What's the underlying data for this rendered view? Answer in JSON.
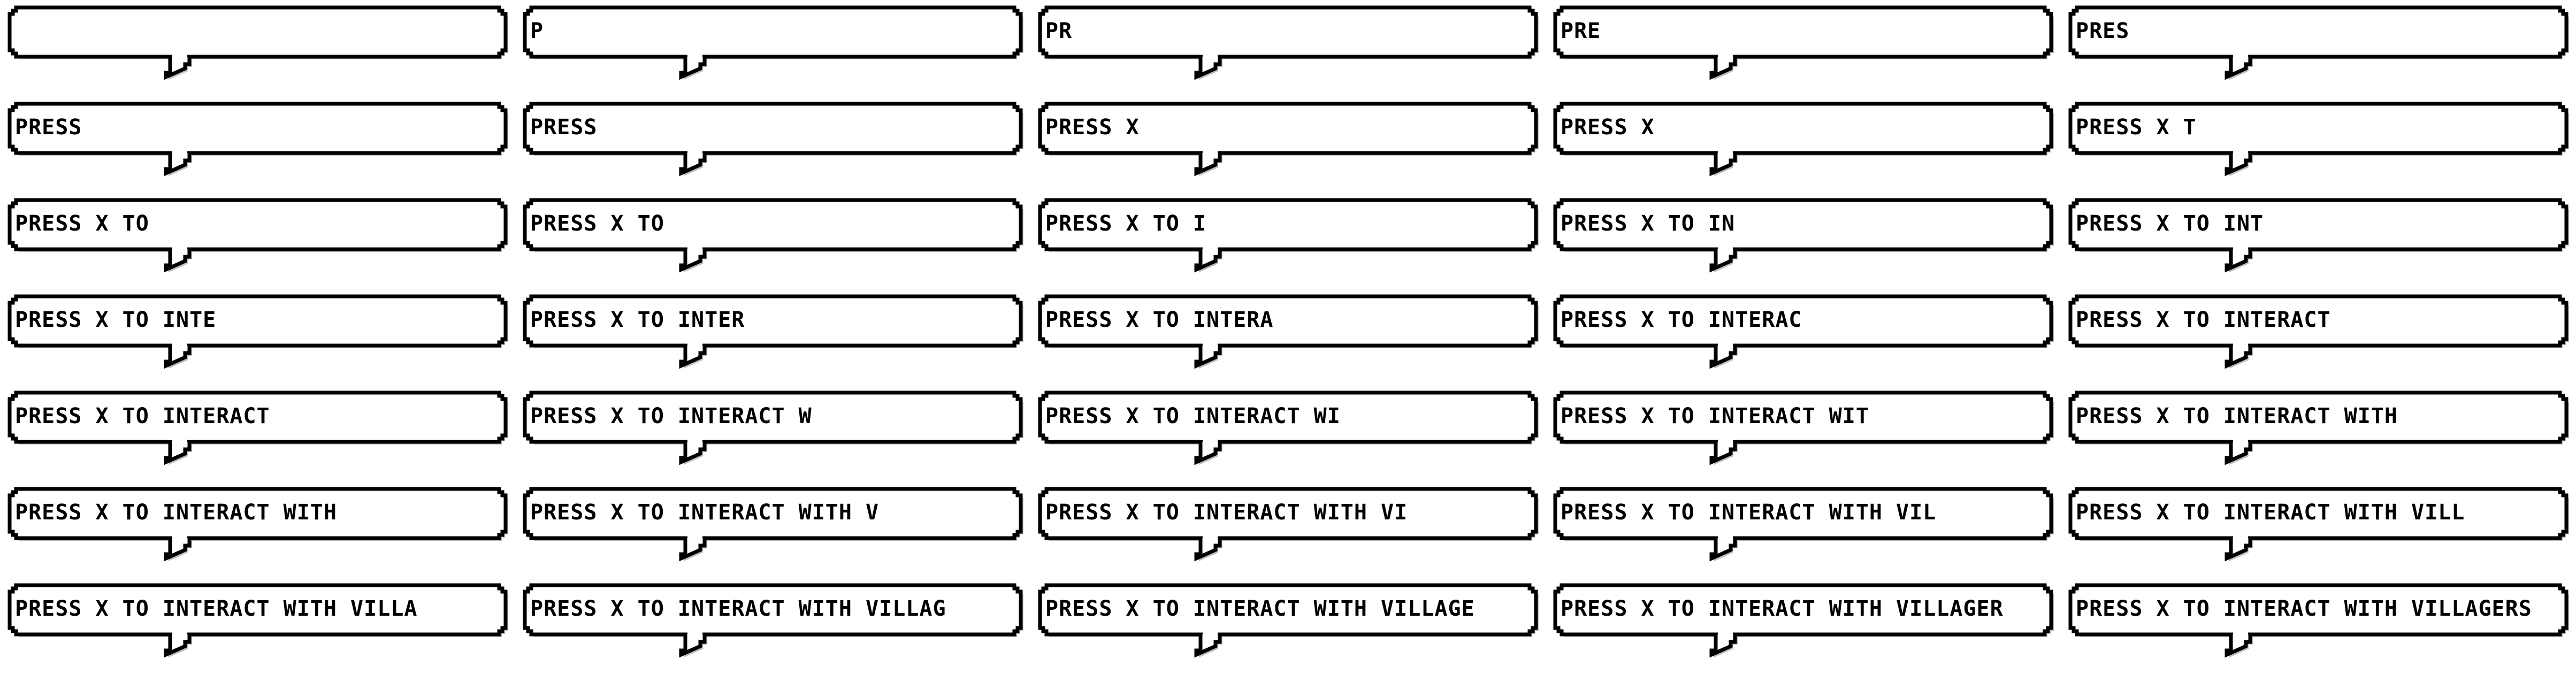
{
  "sprite_sheet": {
    "colors": {
      "outline": "#000000",
      "fill": "#ffffff",
      "shadow": "#bdbdbd"
    },
    "frames": [
      "",
      "P",
      "PR",
      "PRE",
      "PRES",
      "PRESS",
      "PRESS",
      "PRESS X",
      "PRESS X",
      "PRESS X T",
      "PRESS X TO",
      "PRESS X TO",
      "PRESS X TO I",
      "PRESS X TO IN",
      "PRESS X TO INT",
      "PRESS X TO INTE",
      "PRESS X TO INTER",
      "PRESS X TO INTERA",
      "PRESS X TO INTERAC",
      "PRESS X TO INTERACT",
      "PRESS X TO INTERACT",
      "PRESS X TO INTERACT W",
      "PRESS X TO INTERACT WI",
      "PRESS X TO INTERACT WIT",
      "PRESS X TO INTERACT WITH",
      "PRESS X TO INTERACT WITH",
      "PRESS X TO INTERACT WITH V",
      "PRESS X TO INTERACT WITH VI",
      "PRESS X TO INTERACT WITH VIL",
      "PRESS X TO INTERACT WITH VILL",
      "PRESS X TO INTERACT WITH VILLA",
      "PRESS X TO INTERACT WITH VILLAG",
      "PRESS X TO INTERACT WITH VILLAGE",
      "PRESS X TO INTERACT WITH VILLAGER",
      "PRESS X TO INTERACT WITH VILLAGERS"
    ]
  }
}
